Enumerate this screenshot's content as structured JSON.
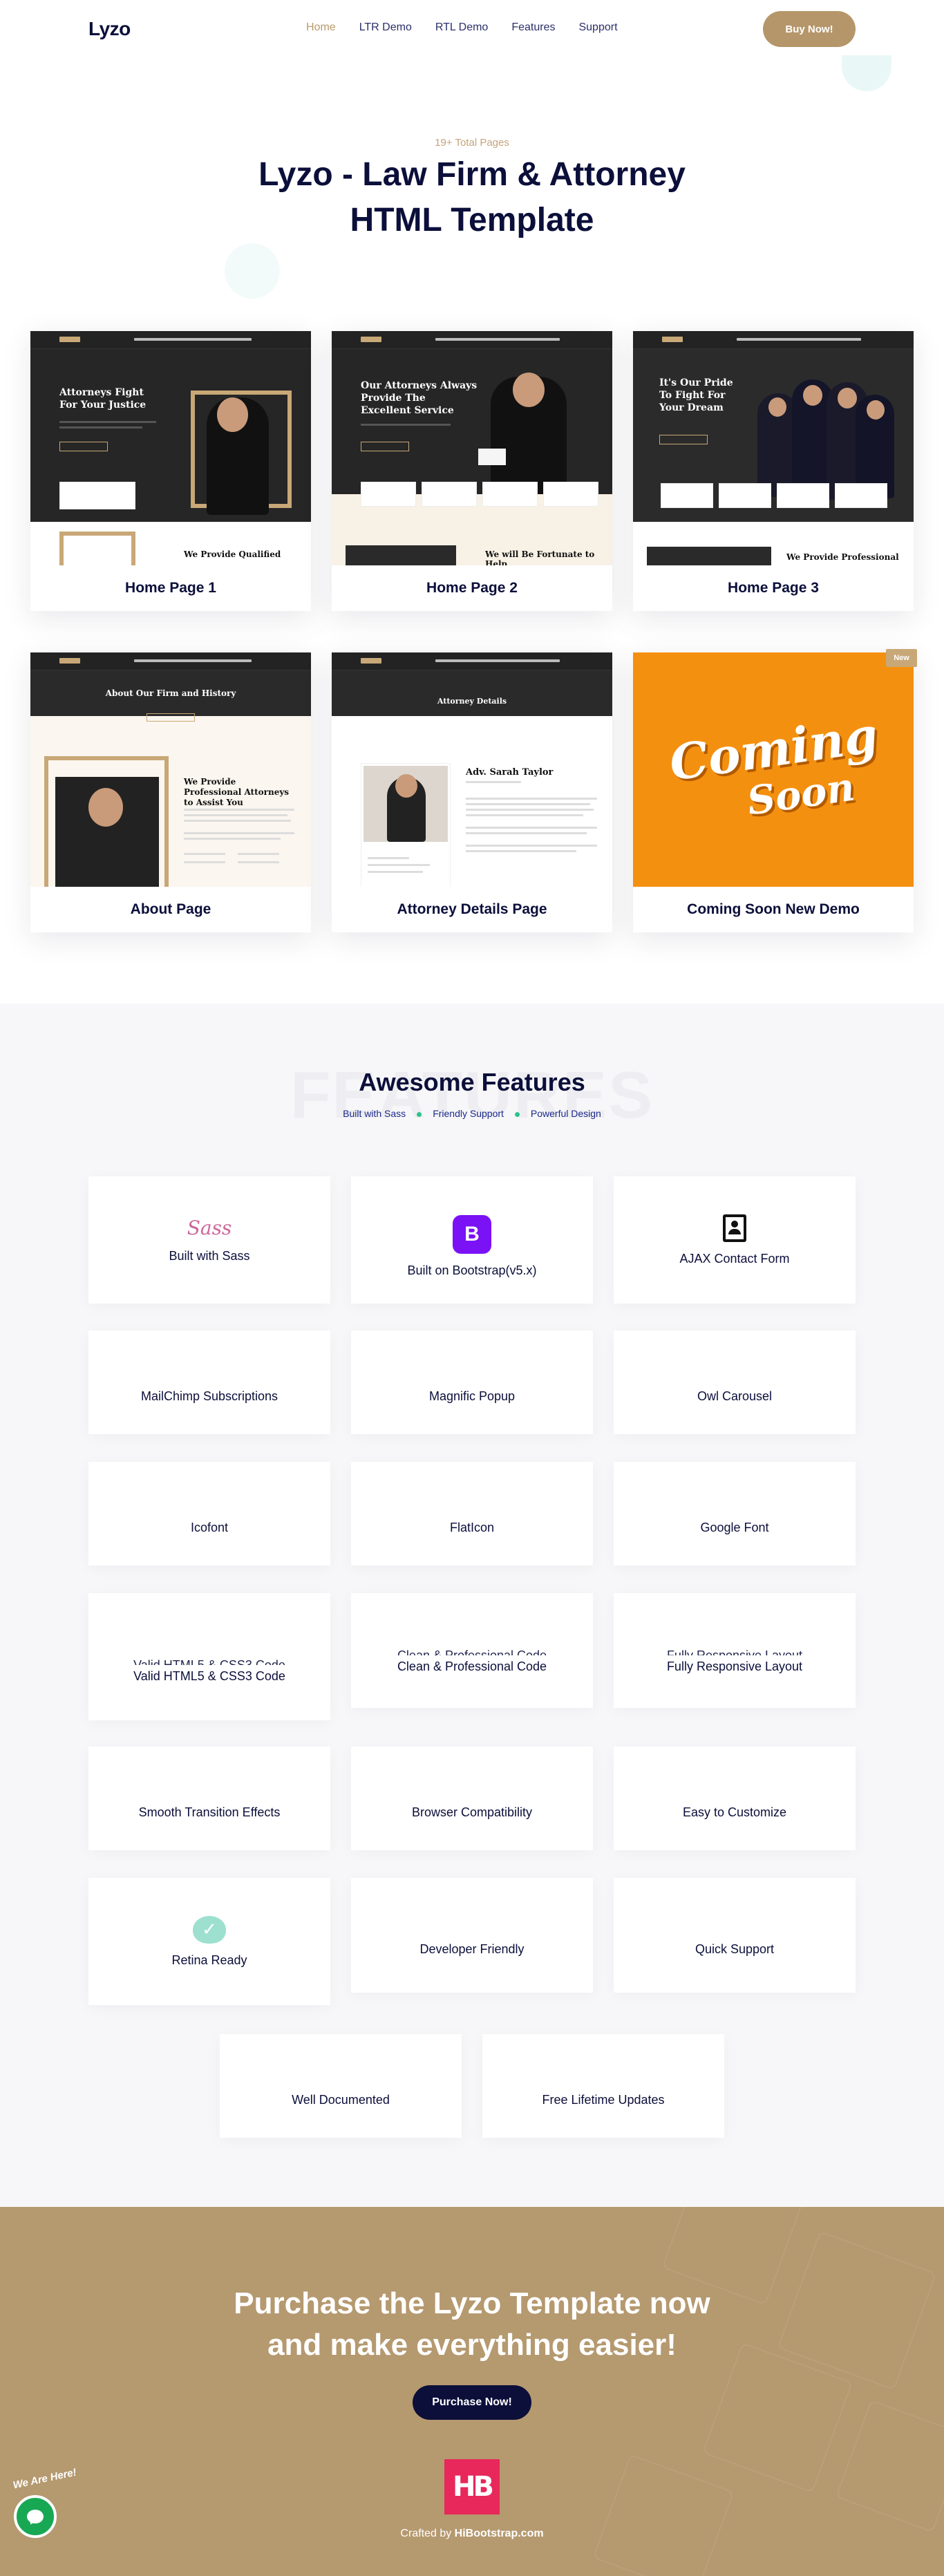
{
  "header": {
    "logo": "Lyzo",
    "nav": [
      "Home",
      "LTR Demo",
      "RTL Demo",
      "Features",
      "Support"
    ],
    "buy_label": "Buy Now!"
  },
  "hero": {
    "subtitle": "19+ Total Pages",
    "title": "Lyzo - Law Firm & Attorney HTML Template"
  },
  "demos": [
    {
      "caption": "Home Page 1",
      "headline": "Attorneys Fight For Your Justice",
      "bottom": "We Provide Qualified"
    },
    {
      "caption": "Home Page 2",
      "headline": "Our Attorneys Always Provide The Excellent Service",
      "bottom": "We will Be Fortunate to Help"
    },
    {
      "caption": "Home Page 3",
      "headline": "It's Our Pride To Fight For Your Dream",
      "bottom": "We Provide Professional"
    },
    {
      "caption": "About Page",
      "headline": "About Our Firm and History",
      "bottom": "We Provide Professional Attorneys to Assist You"
    },
    {
      "caption": "Attorney Details Page",
      "headline": "Attorney Details",
      "bottom": "Adv. Sarah Taylor"
    },
    {
      "caption": "Coming Soon New Demo",
      "headline": "Coming",
      "bottom": "Soon"
    }
  ],
  "new_badge": "New",
  "features": {
    "ghost": "FEATURES",
    "title": "Awesome Features",
    "tags": [
      "Built with Sass",
      "Friendly Support",
      "Powerful Design"
    ],
    "items": [
      "Built with Sass",
      "Built on Bootstrap(v5.x)",
      "AJAX Contact Form",
      "MailChimp Subscriptions",
      "Magnific Popup",
      "Owl Carousel",
      "Icofont",
      "FlatIcon",
      "Google Font",
      "Valid HTML5 & CSS3 Code",
      "Clean & Professional Code",
      "Fully Responsive Layout",
      "Smooth Transition Effects",
      "Browser Compatibility",
      "Easy to Customize",
      "Retina Ready",
      "Developer Friendly",
      "Quick Support",
      "Well Documented",
      "Free Lifetime Updates"
    ],
    "sass_icon_text": "Sass",
    "bootstrap_icon_text": "B"
  },
  "purchase": {
    "title": "Purchase the Lyzo Template now and make everything easier!",
    "button": "Purchase Now!",
    "logo_text": "HB",
    "crafted_prefix": "Crafted by ",
    "crafted_brand": "HiBootstrap.com"
  },
  "chat": {
    "label": "We Are Here!"
  },
  "colors": {
    "gold": "#b5966a",
    "navy": "#0b0f3a",
    "orange": "#f4900f",
    "accent_green": "#2bc38a"
  }
}
